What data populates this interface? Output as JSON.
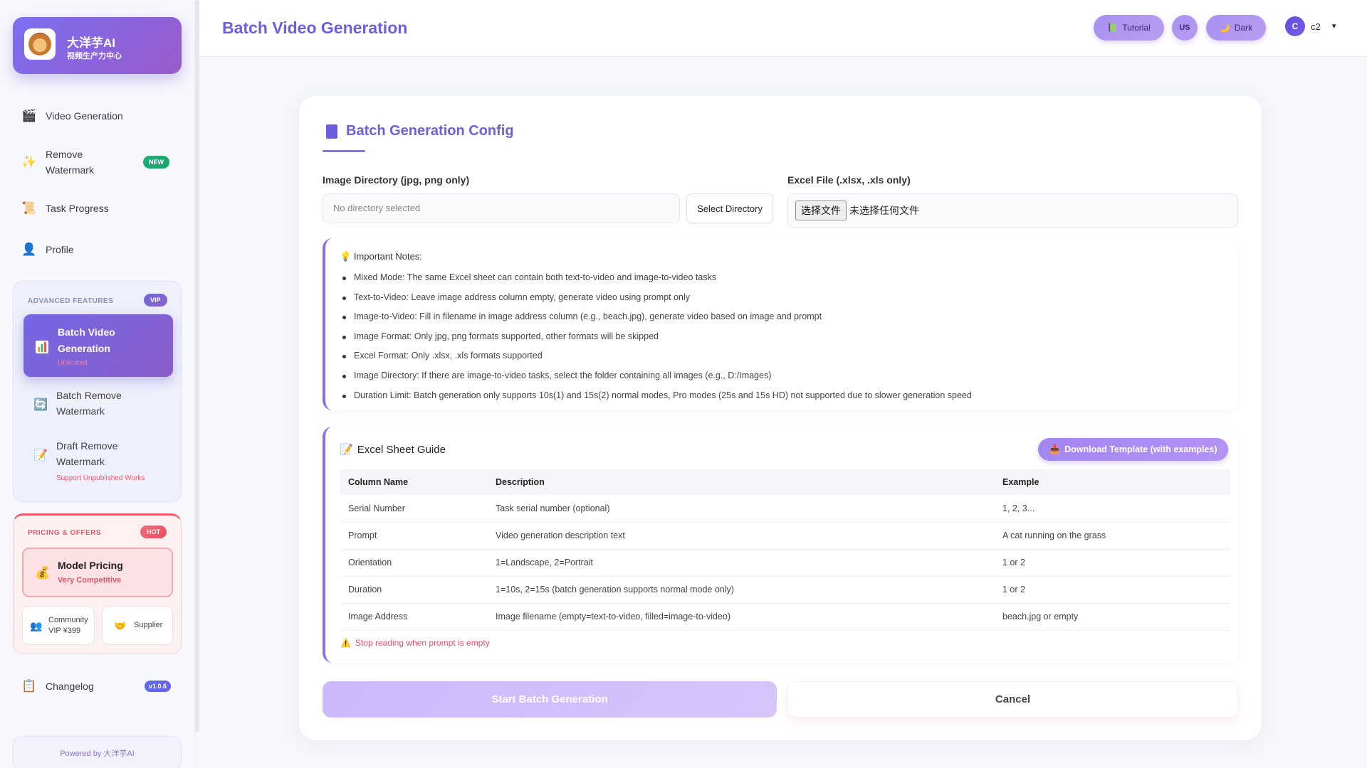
{
  "brand": {
    "name": "大洋芋AI",
    "subtitle": "视频生产力中心"
  },
  "sidebar": {
    "items": [
      {
        "label": "Video Generation",
        "icon": "clapper-icon"
      },
      {
        "label": "Remove Watermark",
        "icon": "sparkles-icon",
        "badge": "NEW"
      },
      {
        "label": "Task Progress",
        "icon": "scroll-icon"
      },
      {
        "label": "Profile",
        "icon": "user-icon"
      }
    ],
    "advanced": {
      "title": "ADVANCED FEATURES",
      "badge": "VIP",
      "items": [
        {
          "label": "Batch Video Generation",
          "sub": "Unlimited",
          "icon": "chart-icon",
          "active": true
        },
        {
          "label": "Batch Remove Watermark",
          "sub": "",
          "icon": "refresh-icon"
        },
        {
          "label": "Draft Remove Watermark",
          "sub": "Support Unpublished Works",
          "icon": "memo-icon"
        }
      ]
    },
    "pricing": {
      "title": "PRICING & OFFERS",
      "badge": "HOT",
      "card_title": "Model Pricing",
      "card_sub": "Very Competitive",
      "community_line1": "Community",
      "community_line2": "VIP ¥399",
      "supplier": "Supplier"
    },
    "changelog": {
      "label": "Changelog",
      "version": "v1.0.6"
    },
    "powered_by": "Powered by 大洋芋AI"
  },
  "header": {
    "title": "Batch Video Generation",
    "tutorial": "Tutorial",
    "lang": "US",
    "theme": "Dark",
    "avatar_letter": "C",
    "username": "c2"
  },
  "config": {
    "title": "Batch Generation Config",
    "image_dir_label": "Image Directory (jpg, png only)",
    "image_dir_placeholder": "No directory selected",
    "select_dir_button": "Select Directory",
    "excel_label": "Excel File (.xlsx, .xls only)",
    "file_button": "选择文件",
    "file_status": "未选择任何文件"
  },
  "notes": {
    "title": "Important Notes:",
    "items": [
      "Mixed Mode: The same Excel sheet can contain both text-to-video and image-to-video tasks",
      "Text-to-Video: Leave image address column empty, generate video using prompt only",
      "Image-to-Video: Fill in filename in image address column (e.g., beach.jpg), generate video based on image and prompt",
      "Image Format: Only jpg, png formats supported, other formats will be skipped",
      "Excel Format: Only .xlsx, .xls formats supported",
      "Image Directory: If there are image-to-video tasks, select the folder containing all images (e.g., D:/Images)",
      "Duration Limit: Batch generation only supports 10s(1) and 15s(2) normal modes, Pro modes (25s and 15s HD) not supported due to slower generation speed"
    ]
  },
  "guide": {
    "title": "Excel Sheet Guide",
    "download_button": "Download Template (with examples)",
    "columns": [
      "Column Name",
      "Description",
      "Example"
    ],
    "rows": [
      [
        "Serial Number",
        "Task serial number (optional)",
        "1, 2, 3..."
      ],
      [
        "Prompt",
        "Video generation description text",
        "A cat running on the grass"
      ],
      [
        "Orientation",
        "1=Landscape, 2=Portrait",
        "1 or 2"
      ],
      [
        "Duration",
        "1=10s, 2=15s (batch generation supports normal mode only)",
        "1 or 2"
      ],
      [
        "Image Address",
        "Image filename (empty=text-to-video, filled=image-to-video)",
        "beach.jpg or empty"
      ]
    ],
    "warning": "Stop reading when prompt is empty"
  },
  "actions": {
    "start": "Start Batch Generation",
    "cancel": "Cancel"
  },
  "colors": {
    "accent": "#6b5fe0",
    "purple_gradient_start": "#7c6ff0",
    "hot": "#f25c6e",
    "new": "#19b37a"
  }
}
